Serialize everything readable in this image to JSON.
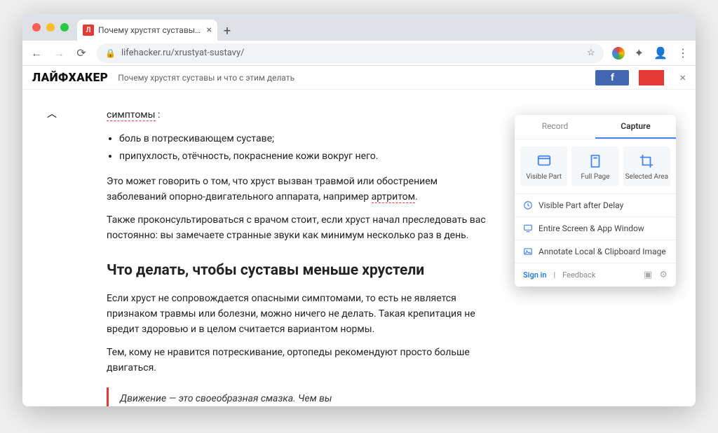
{
  "browser": {
    "tab_title": "Почему хрустят суставы и чт",
    "url": "lifehacker.ru/xrustyat-sustavy/"
  },
  "sitebar": {
    "logo": "ЛАЙФХАКЕР",
    "breadcrumb": "Почему хрустят суставы и что с этим делать"
  },
  "article": {
    "highlight_word": "симптомы",
    "after_highlight": " :",
    "bullets": [
      "боль в потрескивающем суставе;",
      "припухлость, отёчность, покраснение кожи вокруг него."
    ],
    "p1_a": "Это может говорить о том, что хруст вызван травмой или обострением заболеваний опорно-двигательного аппарата, например ",
    "p1_link": "артритом",
    "p1_b": ".",
    "p2": "Также проконсультироваться с врачом стоит, если хруст начал преследовать вас постоянно: вы замечаете странные звуки как минимум несколько раз в день.",
    "h2": "Что делать, чтобы суставы меньше хрустели",
    "p3": "Если хруст не сопровождается опасными симптомами, то есть не является признаком травмы или болезни, можно ничего не делать. Такая крепитация не вредит здоровью и в целом считается вариантом нормы.",
    "p4": "Тем, кому не нравится потрескивание, ортопеды рекомендуют просто больше двигаться.",
    "quote": "Движение — это своеобразная смазка. Чем вы"
  },
  "popup": {
    "tab_record": "Record",
    "tab_capture": "Capture",
    "big": {
      "visible": "Visible Part",
      "full": "Full Page",
      "area": "Selected Area"
    },
    "items": {
      "delay": "Visible Part after Delay",
      "screen": "Entire Screen & App Window",
      "annotate": "Annotate Local & Clipboard Image"
    },
    "signin": "Sign in",
    "feedback": "Feedback"
  }
}
